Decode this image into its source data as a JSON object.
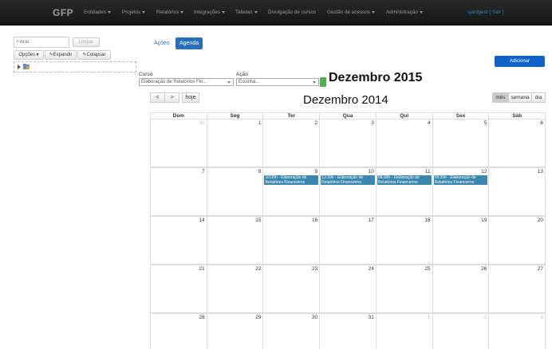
{
  "navbar": {
    "brand": "GFP",
    "items": [
      {
        "label": "Entidades",
        "dropdown": true
      },
      {
        "label": "Projetos",
        "dropdown": true
      },
      {
        "label": "Relatórios",
        "dropdown": true
      },
      {
        "label": "Integrações",
        "dropdown": true
      },
      {
        "label": "Tabelas",
        "dropdown": true
      },
      {
        "label": "Divulgação de cursos",
        "dropdown": false
      },
      {
        "label": "Gestão de acessos",
        "dropdown": true
      },
      {
        "label": "Administração",
        "dropdown": true
      }
    ],
    "user": "sjardgest",
    "logout": "[ Sair ]"
  },
  "left_panel": {
    "filter_placeholder": "Filtrar...",
    "clear_label": "Limpar",
    "options_label": "Opções",
    "expand_label": "Expandir",
    "collapse_label": "Colapsar"
  },
  "tabs": {
    "actions": "Ações",
    "agenda": "Agenda"
  },
  "add_button": "Adicionar",
  "filters": {
    "course_label": "Curso",
    "course_value": "Elaboração de Relatórios Fin...",
    "action_label": "Ação",
    "action_value": "Escolha..."
  },
  "annotation": "Dezembro 2015",
  "calendar": {
    "prev": "<",
    "next": ">",
    "today": "hoje",
    "title": "Dezembro 2014",
    "views": [
      "mês",
      "semana",
      "dia"
    ],
    "active_view": "mês",
    "weekdays": [
      "Dom",
      "Seg",
      "Ter",
      "Qua",
      "Qui",
      "Sex",
      "Sáb"
    ],
    "weeks": [
      [
        {
          "d": "30",
          "other": true
        },
        {
          "d": "1"
        },
        {
          "d": "2"
        },
        {
          "d": "3"
        },
        {
          "d": "4"
        },
        {
          "d": "5"
        },
        {
          "d": "6"
        }
      ],
      [
        {
          "d": "7"
        },
        {
          "d": "8"
        },
        {
          "d": "9",
          "event": "10:00h - Elaboração de Relatórios Financeiros"
        },
        {
          "d": "10",
          "event": "13:30h - Elaboração de Relatórios Financeiros"
        },
        {
          "d": "11",
          "event": "09:30h - Elaboração de Relatórios Financeiros"
        },
        {
          "d": "12",
          "event": "09:30h - Elaboração de Relatórios Financeiros"
        },
        {
          "d": "13"
        }
      ],
      [
        {
          "d": "14"
        },
        {
          "d": "15"
        },
        {
          "d": "16"
        },
        {
          "d": "17"
        },
        {
          "d": "18"
        },
        {
          "d": "19"
        },
        {
          "d": "20"
        }
      ],
      [
        {
          "d": "21"
        },
        {
          "d": "22"
        },
        {
          "d": "23"
        },
        {
          "d": "24"
        },
        {
          "d": "25"
        },
        {
          "d": "26"
        },
        {
          "d": "27"
        }
      ],
      [
        {
          "d": "28"
        },
        {
          "d": "29"
        },
        {
          "d": "30"
        },
        {
          "d": "31"
        },
        {
          "d": "1",
          "other": true
        },
        {
          "d": "2",
          "other": true
        },
        {
          "d": "3",
          "other": true
        }
      ]
    ]
  },
  "colors": {
    "primary": "#0e63c6",
    "event": "#3a87ad",
    "navbar": "#1b1b1b",
    "tag": "#4caf50"
  }
}
